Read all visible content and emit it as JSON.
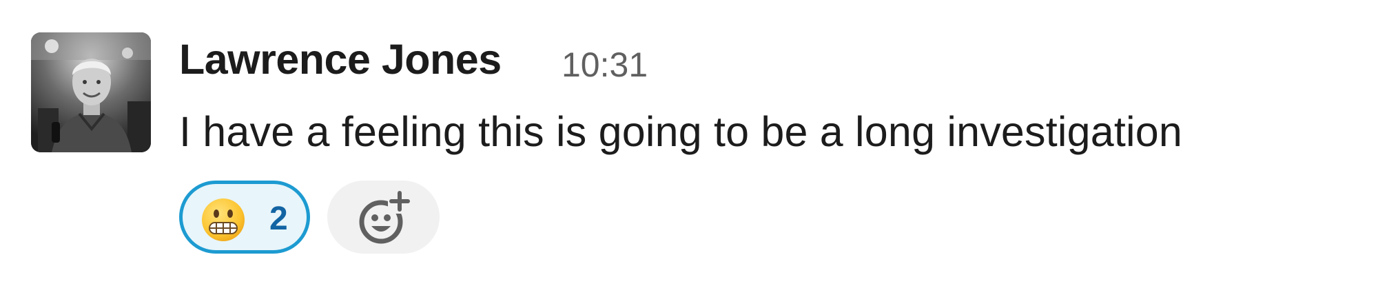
{
  "message": {
    "sender_name": "Lawrence Jones",
    "timestamp": "10:31",
    "text": "I have a feeling this is going to be a long investigation"
  },
  "reactions": [
    {
      "emoji": "grimacing-face",
      "count": "2",
      "reacted_by_me": true
    }
  ],
  "add_reaction": {
    "icon": "add-reaction-icon"
  },
  "colors": {
    "reaction_border": "#1d9bd1",
    "reaction_background": "#e8f5fa",
    "reaction_count": "#1264a3",
    "add_reaction_background": "#f1f1f1",
    "text_primary": "#1d1c1d",
    "text_secondary": "#616061"
  }
}
